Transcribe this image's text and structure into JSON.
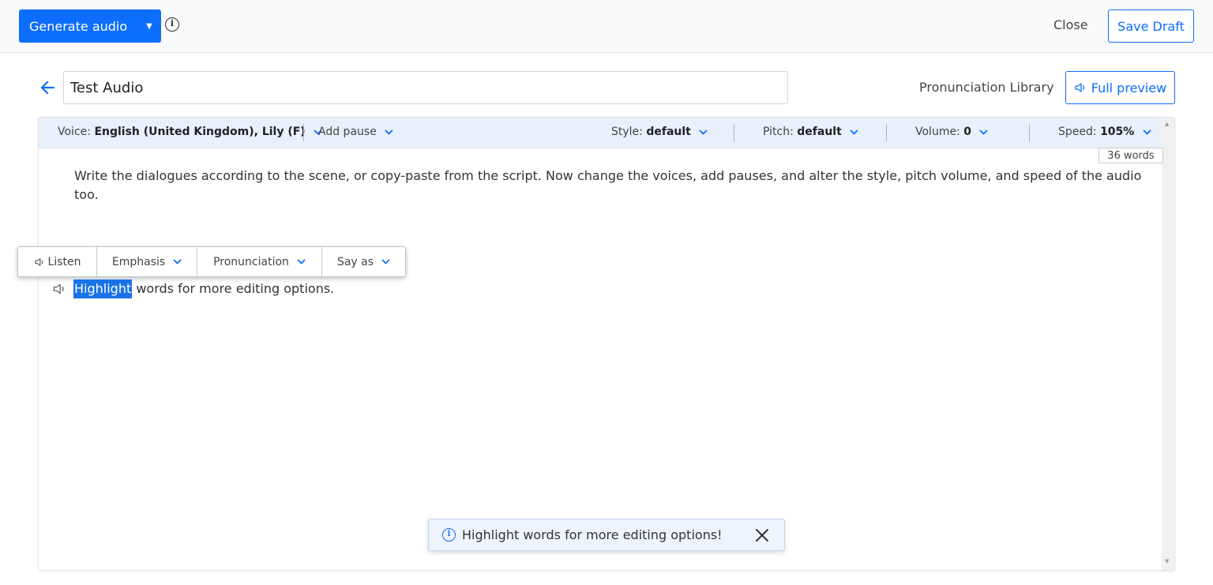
{
  "topbar": {
    "generate_label": "Generate audio",
    "info_icon": "info-circle-icon",
    "close_label": "Close",
    "save_draft_label": "Save Draft"
  },
  "header": {
    "title_value": "Test Audio",
    "pronunciation_library_label": "Pronunciation Library",
    "full_preview_label": "Full preview"
  },
  "toolbar": {
    "voice_label": "Voice:",
    "voice_value": "English (United Kingdom), Lily (F)",
    "add_pause_label": "Add pause",
    "style_label": "Style:",
    "style_value": "default",
    "pitch_label": "Pitch:",
    "pitch_value": "default",
    "volume_label": "Volume:",
    "volume_value": "0",
    "speed_label": "Speed:",
    "speed_value": "105%"
  },
  "editor": {
    "word_count": "36 words",
    "paragraph_line1": "Write the dialogues according to the scene, or copy-paste from the script. Now change the voices, add pauses, and alter the style, pitch volume, and speed of the audio",
    "paragraph_line2": "too.",
    "highlighted_word": "Highlight",
    "line2_rest": " words for more editing options."
  },
  "popover": {
    "listen_label": "Listen",
    "emphasis_label": "Emphasis",
    "pronunciation_label": "Pronunciation",
    "say_as_label": "Say as"
  },
  "toast": {
    "message": "Highlight words for more editing options!"
  },
  "colors": {
    "accent": "#0d6efd",
    "toolbar_bg": "#e8f0fc",
    "highlight": "#1a73e8"
  }
}
